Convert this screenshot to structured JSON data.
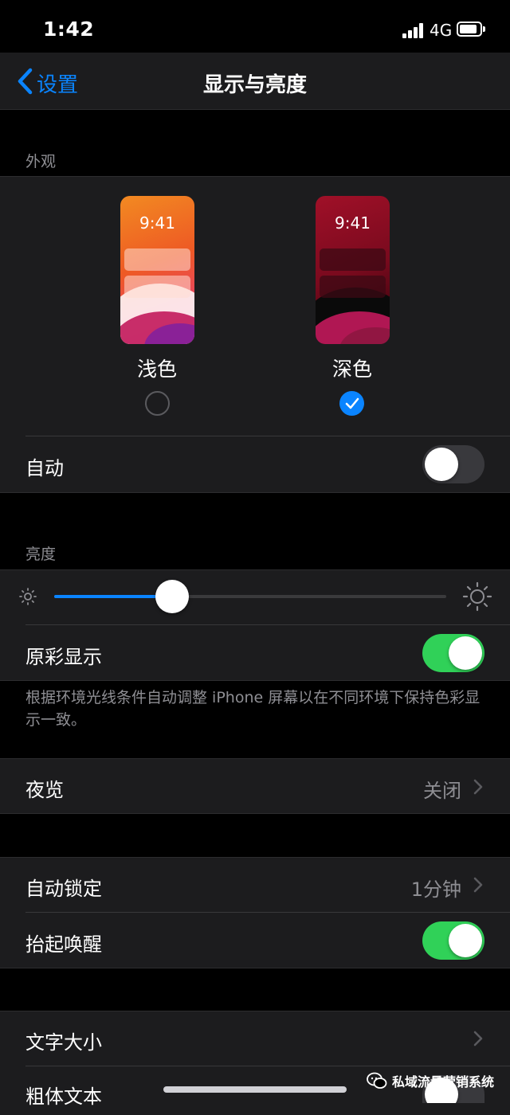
{
  "status": {
    "time": "1:42",
    "network": "4G"
  },
  "nav": {
    "back_label": "设置",
    "title": "显示与亮度"
  },
  "appearance": {
    "header": "外观",
    "light": {
      "preview_time": "9:41",
      "label": "浅色",
      "selected": false
    },
    "dark": {
      "preview_time": "9:41",
      "label": "深色",
      "selected": true
    },
    "auto_label": "自动",
    "auto_on": false
  },
  "brightness": {
    "header": "亮度",
    "level": 0.3,
    "true_tone_label": "原彩显示",
    "true_tone_on": true,
    "footnote": "根据环境光线条件自动调整 iPhone 屏幕以在不同环境下保持色彩显示一致。"
  },
  "night_shift": {
    "label": "夜览",
    "value": "关闭"
  },
  "lock": {
    "auto_lock_label": "自动锁定",
    "auto_lock_value": "1分钟",
    "raise_to_wake_label": "抬起唤醒",
    "raise_to_wake_on": true
  },
  "text": {
    "size_label": "文字大小",
    "bold_label": "粗体文本",
    "bold_on": false
  },
  "watermark": "私域流量营销系统",
  "colors": {
    "accent": "#0a84ff",
    "toggle_on": "#30d158",
    "toggle_off": "#39393d"
  }
}
